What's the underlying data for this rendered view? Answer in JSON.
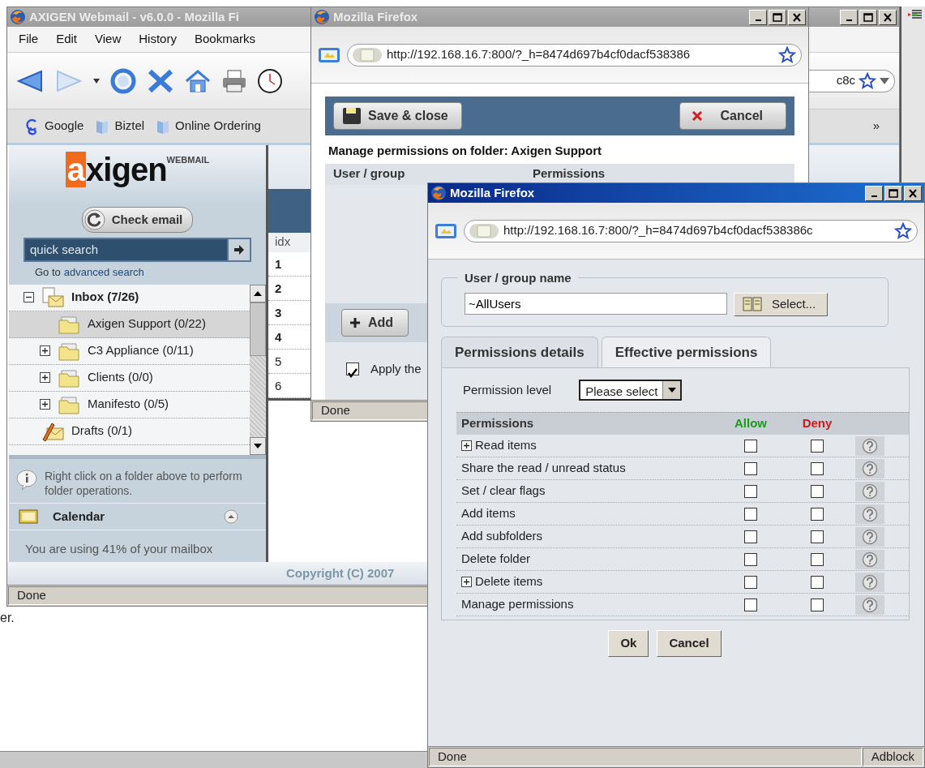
{
  "desktop": {
    "text": "er."
  },
  "main_window": {
    "title": "AXIGEN Webmail - v6.0.0 - Mozilla Fi",
    "active": false,
    "menu": [
      "File",
      "Edit",
      "View",
      "History",
      "Bookmarks"
    ],
    "address_tail": "c8c",
    "bookmarks": [
      {
        "label": "Google",
        "kind": "search"
      },
      {
        "label": "Biztel",
        "kind": "folder"
      },
      {
        "label": "Online Ordering",
        "kind": "folder"
      }
    ],
    "bookmarks_more": "»",
    "logo": "axigen",
    "logo_tag": "WEBMAIL",
    "check_email": "Check email",
    "search": {
      "placeholder": "quick search"
    },
    "advanced_prefix": "Go to",
    "advanced_link": "advanced search",
    "folders": [
      {
        "label": "Inbox (7/26)",
        "kind": "inbox",
        "unread": true,
        "selected": false,
        "expanded": true,
        "children": [
          {
            "label": "Axigen Support (0/22)",
            "kind": "folder",
            "unread": false,
            "selected": true
          },
          {
            "label": "C3 Appliance (0/11)",
            "kind": "folder",
            "unread": false,
            "selected": false,
            "expanded": false
          },
          {
            "label": "Clients (0/0)",
            "kind": "folder",
            "unread": false,
            "selected": false,
            "expanded": false
          },
          {
            "label": "Manifesto (0/5)",
            "kind": "folder",
            "unread": false,
            "selected": false,
            "expanded": false
          }
        ]
      },
      {
        "label": "Drafts (0/1)",
        "kind": "drafts",
        "unread": false,
        "selected": false
      }
    ],
    "info": "Right click on a folder above to perform folder operations.",
    "calendar": "Calendar",
    "quota": "You are using 41% of your mailbox",
    "list_header": "idx",
    "rows": [
      {
        "idx": "1",
        "unread": true
      },
      {
        "idx": "2",
        "unread": true
      },
      {
        "idx": "3",
        "unread": true
      },
      {
        "idx": "4",
        "unread": true
      },
      {
        "idx": "5",
        "unread": false
      },
      {
        "idx": "6",
        "unread": false
      }
    ],
    "copyright": "Copyright (C) 2007",
    "status": "Done"
  },
  "permissions_window": {
    "title": "Mozilla Firefox",
    "active": false,
    "url": "http://192.168.16.7:800/?_h=8474d697b4cf0dacf538386",
    "save": "Save & close",
    "cancel": "Cancel",
    "heading": "Manage permissions on folder: Axigen Support",
    "columns": [
      "User / group",
      "Permissions"
    ],
    "add": "Add",
    "apply": {
      "label": "Apply the",
      "checked": true
    },
    "status": "Done"
  },
  "detail_window": {
    "title": "Mozilla Firefox",
    "active": true,
    "url": "http://192.168.16.7:800/?_h=8474d697b4cf0dacf538386c",
    "legend": "User / group name",
    "user": "~AllUsers",
    "select": "Select...",
    "tabs": [
      {
        "label": "Permissions details",
        "selected": true
      },
      {
        "label": "Effective permissions",
        "selected": false
      }
    ],
    "level_label": "Permission level",
    "level_value": "Please select",
    "table_header": {
      "name": "Permissions",
      "allow": "Allow",
      "deny": "Deny"
    },
    "permissions": [
      {
        "label": "Read items",
        "expanded": false,
        "allow": false,
        "deny": false
      },
      {
        "label": "Share the read / unread status",
        "allow": false,
        "deny": false
      },
      {
        "label": "Set / clear flags",
        "allow": false,
        "deny": false
      },
      {
        "label": "Add items",
        "allow": false,
        "deny": false
      },
      {
        "label": "Add subfolders",
        "allow": false,
        "deny": false
      },
      {
        "label": "Delete folder",
        "allow": false,
        "deny": false
      },
      {
        "label": "Delete items",
        "expanded": false,
        "allow": false,
        "deny": false
      },
      {
        "label": "Manage permissions",
        "allow": false,
        "deny": false
      }
    ],
    "ok": "Ok",
    "cancel": "Cancel",
    "status": "Done",
    "addon": "Adblock"
  }
}
